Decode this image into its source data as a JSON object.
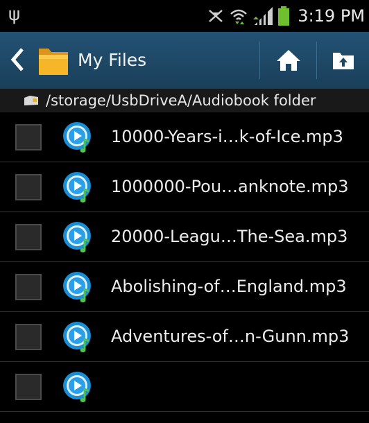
{
  "status_bar": {
    "usb_icon": "usb-icon",
    "time": "3:19 PM",
    "icons": [
      "mute-icon",
      "wifi-icon",
      "signal-icon",
      "battery-icon"
    ]
  },
  "action_bar": {
    "title": "My Files",
    "back_icon": "chevron-left-icon",
    "folder_icon": "folder-icon",
    "home_icon": "home-icon",
    "up_icon": "folder-up-icon",
    "background_color": "#1f4a66"
  },
  "path_bar": {
    "path": "/storage/UsbDriveA/Audiobook folder"
  },
  "files": [
    {
      "name": "10000-Years-i…k-of-Ice.mp3",
      "icon": "audio-file-icon",
      "checked": false
    },
    {
      "name": "1000000-Pou…anknote.mp3",
      "icon": "audio-file-icon",
      "checked": false
    },
    {
      "name": "20000-Leagu…The-Sea.mp3",
      "icon": "audio-file-icon",
      "checked": false
    },
    {
      "name": "Abolishing-of…England.mp3",
      "icon": "audio-file-icon",
      "checked": false
    },
    {
      "name": "Adventures-of…n-Gunn.mp3",
      "icon": "audio-file-icon",
      "checked": false
    },
    {
      "name": "",
      "icon": "audio-file-icon",
      "checked": false
    }
  ]
}
